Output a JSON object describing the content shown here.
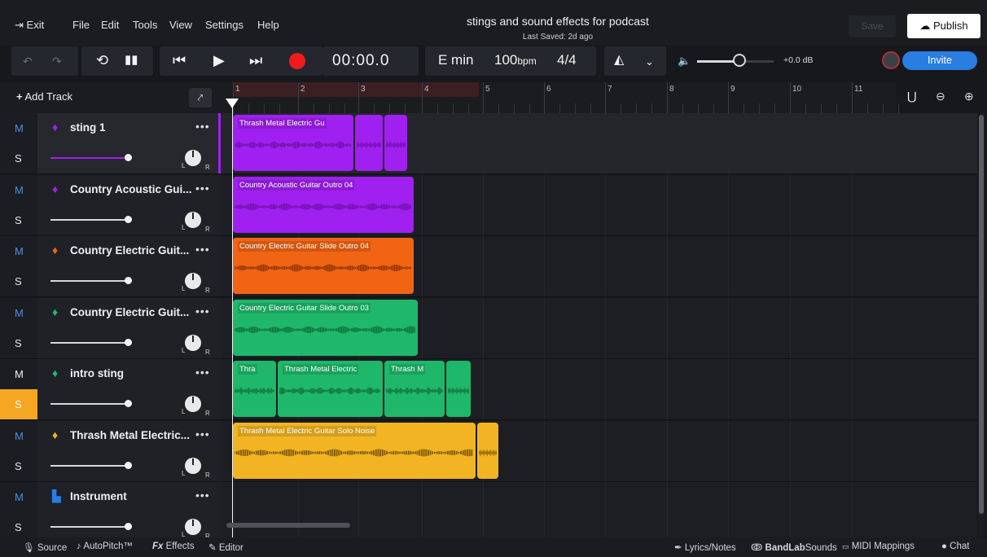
{
  "menu": {
    "exit": "Exit",
    "items": [
      "File",
      "Edit",
      "Tools",
      "View",
      "Settings",
      "Help"
    ]
  },
  "project": {
    "title": "stings and sound effects for podcast",
    "last_saved": "Last Saved: 2d ago"
  },
  "actions": {
    "save": "Save",
    "publish": "Publish",
    "invite": "Invite"
  },
  "transport": {
    "time": "00:00.0",
    "key": "E min",
    "tempo": "100",
    "tempo_unit": "bpm",
    "time_signature": "4/4",
    "volume_db": "+0.0 dB",
    "volume_level": 0.55
  },
  "ruler": {
    "add_track": "Add Track",
    "bars": [
      "1",
      "2",
      "3",
      "4",
      "5",
      "6",
      "7",
      "8",
      "9",
      "10",
      "11"
    ]
  },
  "tracks": [
    {
      "name": "sting 1",
      "color": "#a020f0",
      "icon": "mic-icon",
      "mute": "M",
      "solo": "S",
      "clips": [
        {
          "label": "Thrash Metal Electric Gu"
        }
      ]
    },
    {
      "name": "Country Acoustic Gui...",
      "color": "#a020f0",
      "icon": "mic-icon",
      "mute": "M",
      "solo": "S",
      "clips": [
        {
          "label": "Country Acoustic Guitar Outro 04"
        }
      ]
    },
    {
      "name": "Country Electric Guit...",
      "color": "#f06414",
      "icon": "mic-icon",
      "mute": "M",
      "solo": "S",
      "clips": [
        {
          "label": "Country Electric Guitar Slide Outro 04"
        }
      ]
    },
    {
      "name": "Country Electric Guit...",
      "color": "#1fb86a",
      "icon": "mic-icon",
      "mute": "M",
      "solo": "S",
      "clips": [
        {
          "label": "Country Electric Guitar Slide Outro 03"
        }
      ]
    },
    {
      "name": "intro sting",
      "color": "#1fb86a",
      "icon": "mic-icon",
      "mute": "M",
      "solo": "S",
      "clips": [
        {
          "label": "Thra"
        },
        {
          "label": "Thrash Metal Electric"
        },
        {
          "label": "Thrash M"
        }
      ]
    },
    {
      "name": "Thrash Metal Electric...",
      "color": "#f2b422",
      "icon": "mic-icon",
      "mute": "M",
      "solo": "S",
      "clips": [
        {
          "label": "Thrash Metal Electric Guitar Solo Noise"
        }
      ]
    },
    {
      "name": "Instrument",
      "color": "#2a7de1",
      "icon": "piano-icon",
      "mute": "M",
      "solo": "S",
      "clips": []
    }
  ],
  "bottom": {
    "source": "Source",
    "autopitch": "AutoPitch™",
    "effects": "Effects",
    "editor": "Editor",
    "lyrics": "Lyrics/Notes",
    "bandlab_brand": "BandLab",
    "bandlab_sounds": "Sounds",
    "midi": "MIDI Mappings",
    "chat": "Chat"
  }
}
